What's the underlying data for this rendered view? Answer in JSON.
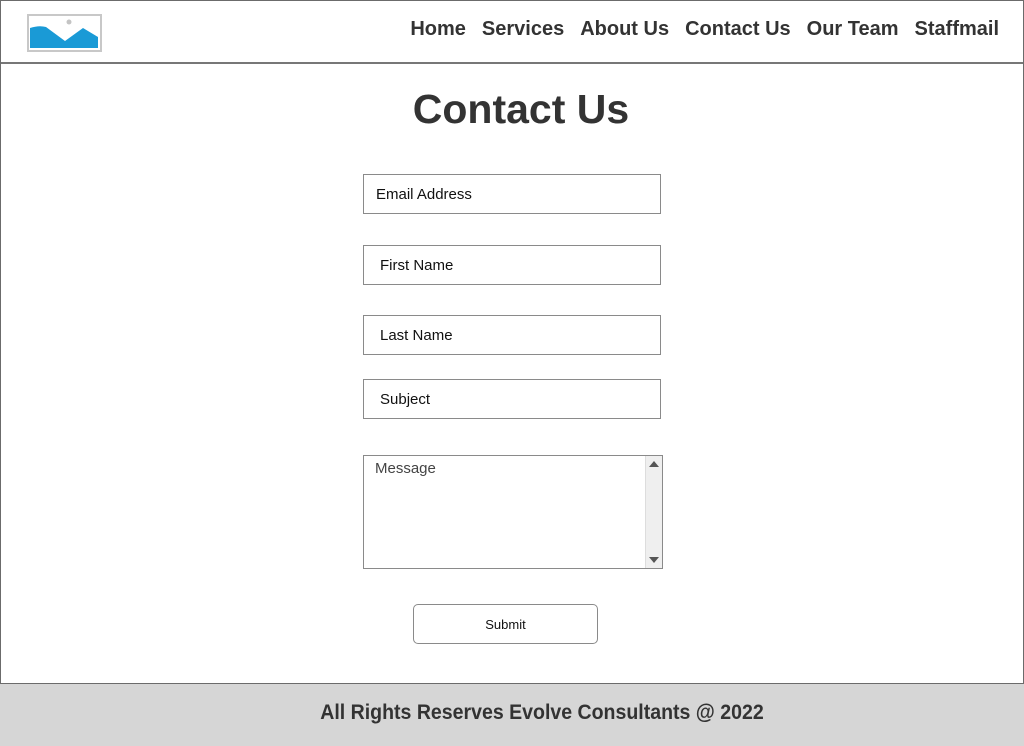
{
  "header": {
    "logo": {
      "icon": "image-placeholder-icon",
      "color": "#1a9ad6"
    },
    "nav": [
      {
        "label": "Home"
      },
      {
        "label": "Services"
      },
      {
        "label": "About Us"
      },
      {
        "label": "Contact Us"
      },
      {
        "label": "Our Team"
      },
      {
        "label": "Staffmail"
      }
    ]
  },
  "main": {
    "title": "Contact Us",
    "form": {
      "email_placeholder": "Email Address",
      "first_name_placeholder": "First Name",
      "last_name_placeholder": "Last Name",
      "subject_placeholder": "Subject",
      "message_placeholder": "Message",
      "submit_label": "Submit"
    }
  },
  "footer": {
    "text": "All Rights Reserves Evolve Consultants @ 2022",
    "background": "#d6d6d6"
  }
}
